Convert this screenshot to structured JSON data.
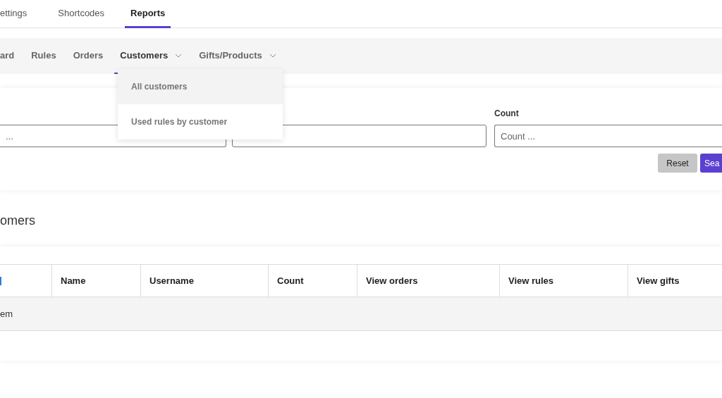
{
  "top_tabs": [
    {
      "label": "ettings",
      "selected": false
    },
    {
      "label": "Shortcodes",
      "selected": false
    },
    {
      "label": "Reports",
      "selected": true
    }
  ],
  "sub_nav": [
    {
      "label": "ard",
      "selected": false,
      "has_menu": false
    },
    {
      "label": "Rules",
      "selected": false,
      "has_menu": false
    },
    {
      "label": "Orders",
      "selected": false,
      "has_menu": false
    },
    {
      "label": "Customers",
      "selected": true,
      "has_menu": true
    },
    {
      "label": "Gifts/Products",
      "selected": false,
      "has_menu": true
    }
  ],
  "dropdown": [
    {
      "label": "All customers",
      "selected": true
    },
    {
      "label": "Used rules by customer",
      "selected": false
    }
  ],
  "filters": {
    "fields": [
      {
        "kind": "input",
        "placeholder": "..."
      },
      {
        "kind": "input"
      },
      {
        "kind": "input",
        "label": "Count",
        "placeholder": "Count ..."
      }
    ],
    "buttons": [
      {
        "label": "Reset",
        "kind": "secondary"
      },
      {
        "label": "Sea",
        "kind": "primary"
      }
    ]
  },
  "heading": "omers",
  "table": {
    "columns": [
      "Name",
      "Username",
      "Count",
      "View orders",
      "View rules",
      "View gifts"
    ],
    "rows": [
      {
        "text": "em"
      }
    ]
  }
}
